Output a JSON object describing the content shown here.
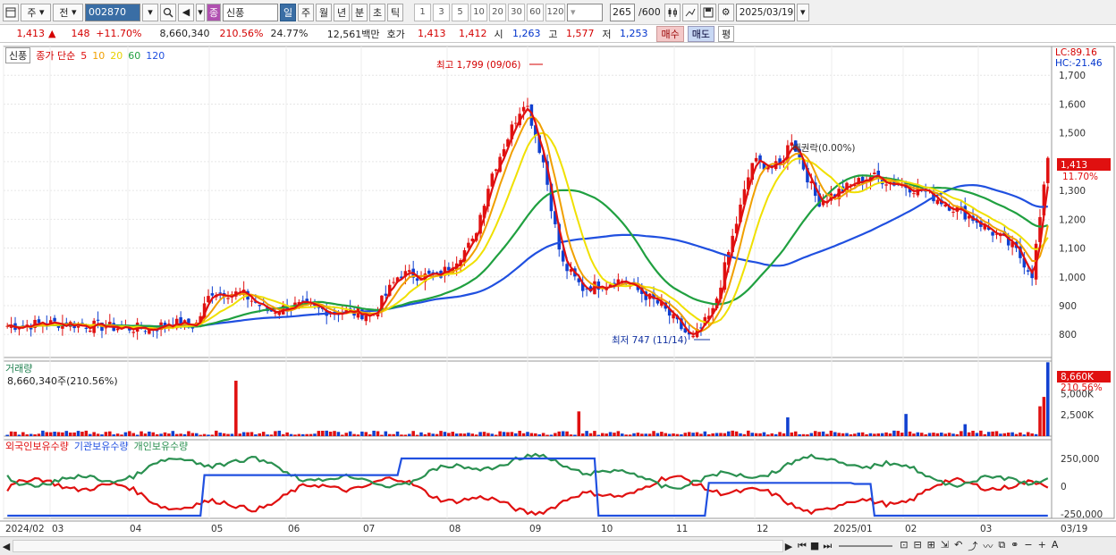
{
  "toolbar": {
    "type1": "주",
    "type2": "전",
    "code": "002870",
    "name_tag": "종",
    "name": "신풍",
    "periods": [
      "일",
      "주",
      "월",
      "년",
      "분",
      "초",
      "틱"
    ],
    "intervals": [
      "1",
      "3",
      "5",
      "10",
      "20",
      "30",
      "60",
      "120"
    ],
    "count": "265",
    "count_total": "/600",
    "date": "2025/03/19"
  },
  "quote": {
    "price": "1,413",
    "arrow": "▲",
    "change": "148",
    "change_pct": "+11.70%",
    "volume": "8,660,340",
    "vol_ratio": "210.56%",
    "turnover": "24.77%",
    "amount": "12,561백만",
    "hoga_label": "호가",
    "ask": "1,413",
    "bid": "1,412",
    "open_label": "시",
    "open": "1,263",
    "high_label": "고",
    "high": "1,577",
    "low_label": "저",
    "low": "1,253",
    "buy": "매수",
    "sell": "매도",
    "eval": "평"
  },
  "price_panel": {
    "name": "신풍",
    "ma_label": "종가 단순",
    "ma": [
      "5",
      "10",
      "20",
      "60",
      "120"
    ],
    "lc": "LC:89.16",
    "hc": "HC:-21.46",
    "high_note": "최고 1,799 (09/06)",
    "low_note": "최저 747 (11/14)",
    "ex_note": "배권락(0.00%)",
    "last_price": "1,413",
    "last_pct": "11.70%",
    "yticks": [
      "1,700",
      "1,600",
      "1,500",
      "1,400",
      "1,300",
      "1,200",
      "1,100",
      "1,000",
      "900",
      "800"
    ]
  },
  "volume_panel": {
    "title": "거래량",
    "value": "8,660,340주(210.56%)",
    "last": "8,660K",
    "last_pct": "210.56%",
    "yticks": [
      "5,000K",
      "2,500K"
    ]
  },
  "holding_panel": {
    "series": [
      "외국인보유수량",
      "기관보유수량",
      "개인보유수량"
    ],
    "yticks": [
      "250,000",
      "0",
      "-250,000"
    ]
  },
  "xaxis": [
    "2024/02",
    "03",
    "04",
    "05",
    "06",
    "07",
    "08",
    "09",
    "10",
    "11",
    "12",
    "2025/01",
    "02",
    "03",
    "03/19"
  ],
  "colors": {
    "ma5": "#e01010",
    "ma10": "#f0a000",
    "ma20": "#f0e000",
    "ma60": "#20a040",
    "ma120": "#2050e0",
    "up": "#e01010",
    "down": "#1040d0",
    "foreign": "#e01010",
    "inst": "#2050e0",
    "indiv": "#2a9050"
  },
  "chart_data": {
    "type": "line",
    "title": "신풍 일봉",
    "x": [
      "2024/02",
      "03",
      "04",
      "05",
      "06",
      "07",
      "08",
      "09",
      "10",
      "11",
      "12",
      "2025/01",
      "02",
      "03"
    ],
    "series": [
      {
        "name": "5",
        "values": [
          830,
          840,
          820,
          950,
          920,
          880,
          1000,
          1600,
          1000,
          900,
          1250,
          1350,
          1300,
          1150
        ]
      },
      {
        "name": "60",
        "values": [
          835,
          835,
          830,
          860,
          880,
          890,
          980,
          1080,
          1110,
          1080,
          860,
          1100,
          1230,
          1290
        ]
      },
      {
        "name": "120",
        "values": [
          855,
          845,
          835,
          840,
          860,
          870,
          920,
          990,
          1010,
          1010,
          1010,
          1100,
          1170,
          1150
        ]
      }
    ],
    "ylim": [
      720,
      1800
    ]
  }
}
